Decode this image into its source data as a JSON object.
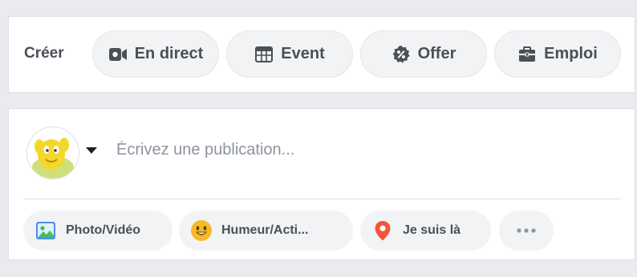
{
  "create_bar": {
    "label": "Créer",
    "buttons": [
      {
        "label": "En direct",
        "icon": "video-camera-icon"
      },
      {
        "label": "Event",
        "icon": "calendar-icon"
      },
      {
        "label": "Offer",
        "icon": "percent-badge-icon"
      },
      {
        "label": "Emploi",
        "icon": "briefcase-icon"
      }
    ]
  },
  "composer": {
    "placeholder": "Écrivez une publication...",
    "avatar_icon": "profile-avatar",
    "actions": [
      {
        "label": "Photo/Vidéo",
        "icon": "photo-icon"
      },
      {
        "label": "Humeur/Acti...",
        "icon": "smiley-icon"
      },
      {
        "label": "Je suis là",
        "icon": "location-pin-icon"
      }
    ],
    "more_icon": "more-dots-icon"
  },
  "colors": {
    "background": "#e9ebee",
    "card": "#ffffff",
    "pill": "#f2f3f5",
    "text": "#4b4f56",
    "placeholder": "#8d949e",
    "photo_green": "#45bd62",
    "smiley_yellow": "#f7b928",
    "pin_red": "#f5533d"
  }
}
